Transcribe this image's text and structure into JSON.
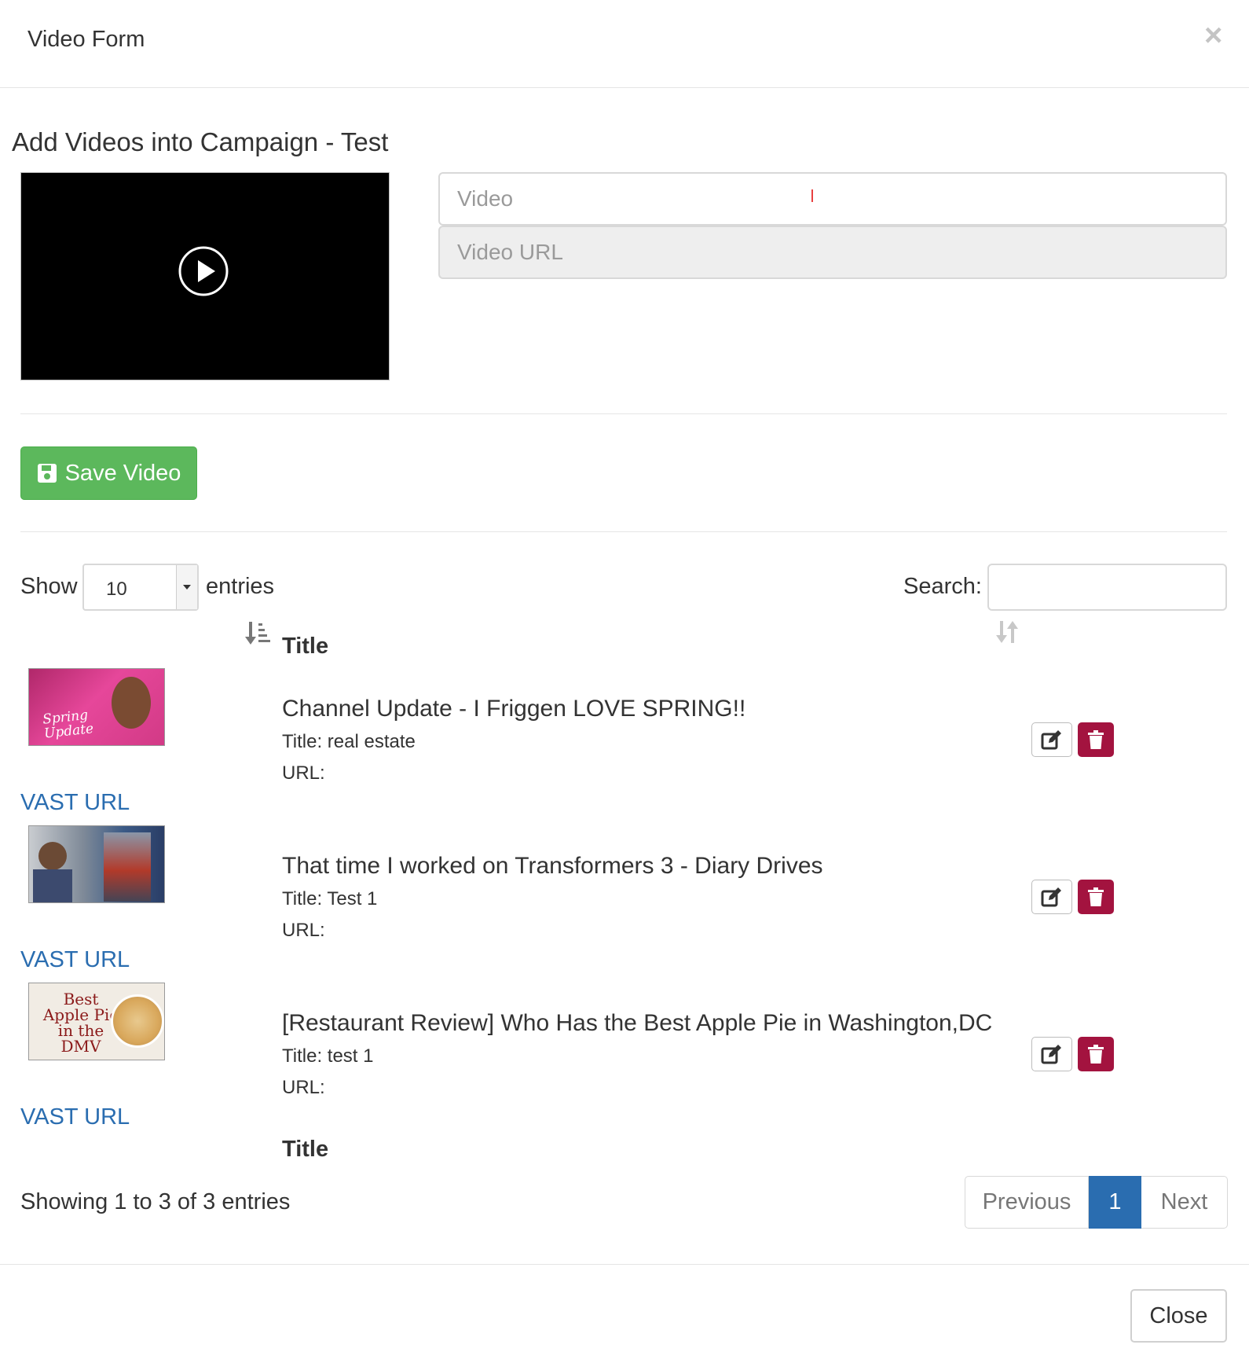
{
  "modal": {
    "title": "Video Form",
    "close_glyph": "×"
  },
  "form": {
    "heading": "Add Videos into Campaign - Test",
    "video_placeholder": "Video",
    "video_url_placeholder": "Video URL",
    "save_label": "Save Video"
  },
  "table_controls": {
    "show_label": "Show",
    "entries_label": "entries",
    "page_length": "10",
    "search_label": "Search:",
    "search_value": ""
  },
  "table": {
    "header_title": "Title",
    "footer_title": "Title",
    "rows": [
      {
        "name": "Channel Update - I Friggen LOVE SPRING!!",
        "title_line": "Title: real estate",
        "url_line": "URL:",
        "vast_label": "VAST URL",
        "thumb_text": "Spring Update"
      },
      {
        "name": "That time I worked on Transformers 3 - Diary Drives",
        "title_line": "Title: Test 1",
        "url_line": "URL:",
        "vast_label": "VAST URL",
        "thumb_text": ""
      },
      {
        "name": "[Restaurant Review] Who Has the Best Apple Pie in Washington,DC",
        "title_line": "Title: test 1",
        "url_line": "URL:",
        "vast_label": "VAST URL",
        "thumb_text": "Best Apple Pie in the DMV"
      }
    ]
  },
  "footer": {
    "info": "Showing 1 to 3 of 3 entries",
    "previous_label": "Previous",
    "current_page": "1",
    "next_label": "Next",
    "close_label": "Close"
  },
  "colors": {
    "save_button": "#5cb85c",
    "link": "#2a6db0",
    "delete_button": "#a3133f",
    "active_page": "#2a6db0"
  },
  "icons": {
    "play": "play-circle-icon",
    "save": "floppy-disk-icon",
    "sort_active": "sort-amount-down-icon",
    "sort_inactive": "sort-icon",
    "edit": "edit-icon",
    "delete": "trash-icon",
    "select_arrow": "caret-down-icon"
  }
}
